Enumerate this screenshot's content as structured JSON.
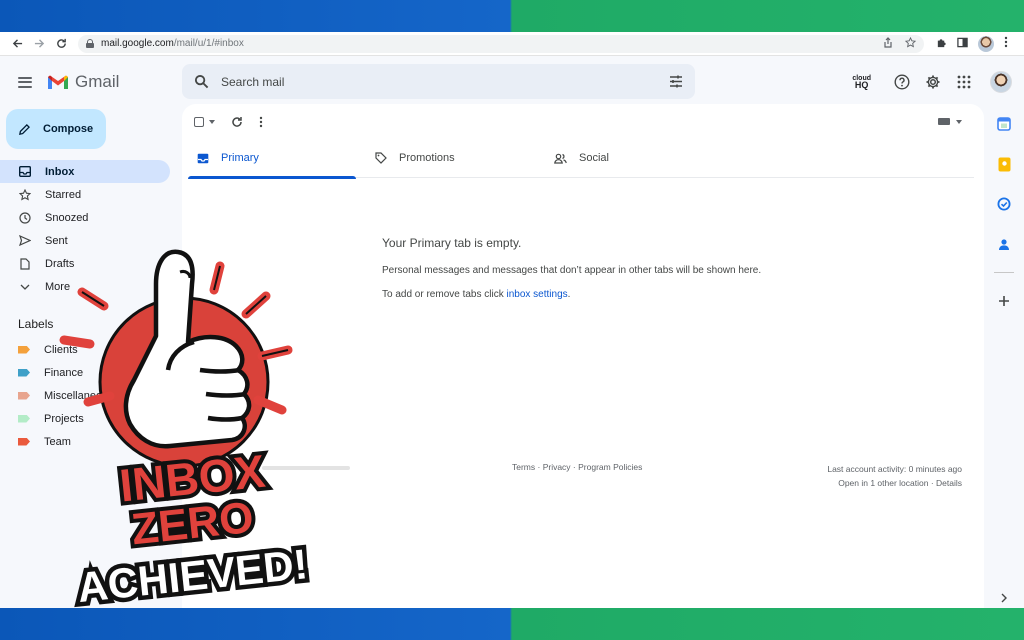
{
  "browser": {
    "url_host": "mail.google.com",
    "url_path": "/mail/u/1/#inbox"
  },
  "app": {
    "name": "Gmail",
    "search_placeholder": "Search mail",
    "cloudhq_top": "cloud",
    "cloudhq_bottom": "HQ"
  },
  "sidebar": {
    "compose_label": "Compose",
    "items": [
      {
        "label": "Inbox",
        "icon": "inbox-icon"
      },
      {
        "label": "Starred",
        "icon": "star-icon"
      },
      {
        "label": "Snoozed",
        "icon": "clock-icon"
      },
      {
        "label": "Sent",
        "icon": "send-icon"
      },
      {
        "label": "Drafts",
        "icon": "draft-icon"
      },
      {
        "label": "More",
        "icon": "chevron-down-icon"
      }
    ],
    "labels_title": "Labels",
    "labels": [
      {
        "label": "Clients",
        "color": "#f4a13c"
      },
      {
        "label": "Finance",
        "color": "#3fa0c8"
      },
      {
        "label": "Miscellaneous",
        "color": "#e8a58f"
      },
      {
        "label": "Projects",
        "color": "#b3ecc7"
      },
      {
        "label": "Team",
        "color": "#ea5a3d"
      }
    ]
  },
  "main": {
    "tabs": [
      {
        "label": "Primary"
      },
      {
        "label": "Promotions"
      },
      {
        "label": "Social"
      }
    ],
    "empty_title": "Your Primary tab is empty.",
    "empty_line1": "Personal messages and messages that don’t appear in other tabs will be shown here.",
    "empty_line2_prefix": "To add or remove tabs click ",
    "empty_line2_link": "inbox settings",
    "empty_line2_suffix": ".",
    "footer_links": "Terms · Privacy · Program Policies",
    "last_activity": "Last account activity: 0 minutes ago",
    "other_location": "Open in 1 other location · Details"
  },
  "sticker": {
    "line1": "INBOX",
    "line2": "ZERO",
    "line3": "ACHIEVED!"
  },
  "colors": {
    "compose_bg": "#c2e7ff",
    "active_nav": "#d3e3fd",
    "accent_blue": "#0b57d0",
    "sticker_red": "#e0423c",
    "sticker_orange": "#f26b3a"
  }
}
